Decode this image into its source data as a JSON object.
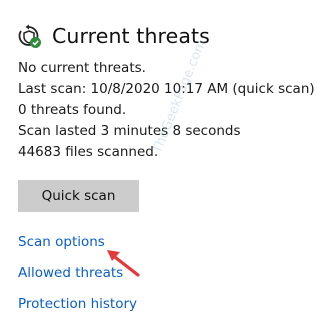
{
  "header": {
    "title": "Current threats",
    "icon": "shield-check-icon"
  },
  "status": {
    "lines": [
      "No current threats.",
      "Last scan: 10/8/2020 10:17 AM (quick scan)",
      "0 threats found.",
      "Scan lasted 3 minutes 8 seconds",
      "44683 files scanned."
    ]
  },
  "actions": {
    "quick_scan_label": "Quick scan"
  },
  "links": {
    "scan_options": "Scan options",
    "allowed_threats": "Allowed threats",
    "protection_history": "Protection history"
  },
  "annotation": {
    "arrow_color": "#e03a3a"
  },
  "watermark": {
    "text": "TheGeekPage.com"
  },
  "colors": {
    "link": "#0a5ec9",
    "button_bg": "#cccccc",
    "check_badge": "#2e8b3a"
  }
}
